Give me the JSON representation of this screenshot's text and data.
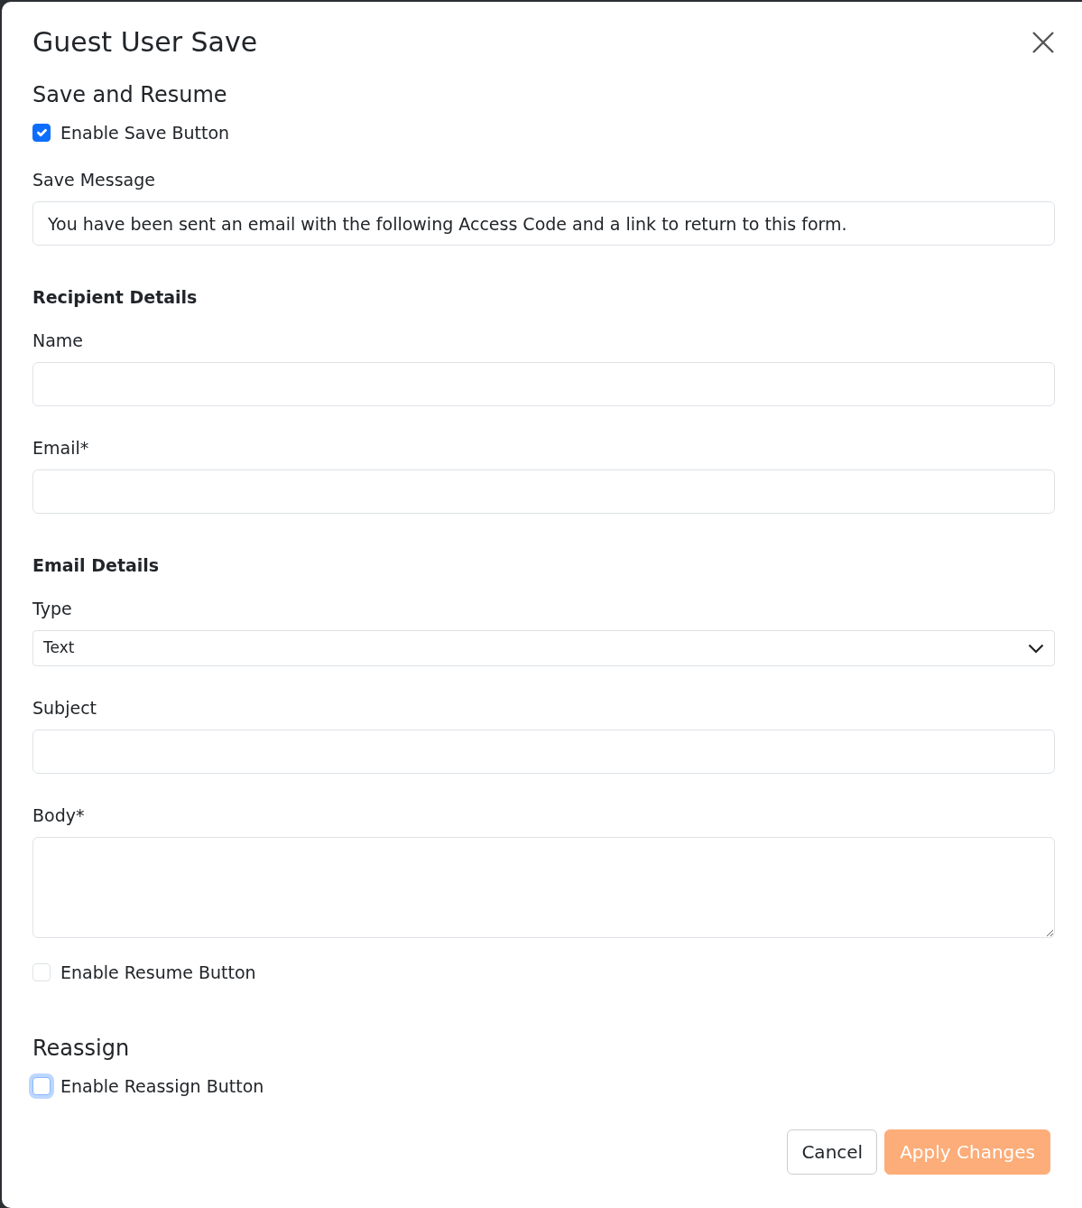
{
  "dialog": {
    "title": "Guest User Save"
  },
  "items": [
    {
      "kind": "heading",
      "text": "Save and Resume"
    },
    {
      "kind": "checkbox",
      "label": "Enable Save Button",
      "checked": true,
      "focused": false
    },
    {
      "kind": "input",
      "label": "Save Message",
      "value": "You have been sent an email with the following Access Code and a link to return to this form."
    },
    {
      "kind": "subheading",
      "text": "Recipient Details"
    },
    {
      "kind": "input",
      "label": "Name",
      "value": ""
    },
    {
      "kind": "input",
      "label": "Email*",
      "value": ""
    },
    {
      "kind": "subheading",
      "text": "Email Details"
    },
    {
      "kind": "select",
      "label": "Type",
      "value": "Text"
    },
    {
      "kind": "input",
      "label": "Subject",
      "value": ""
    },
    {
      "kind": "textarea",
      "label": "Body*",
      "value": ""
    },
    {
      "kind": "checkbox",
      "label": "Enable Resume Button",
      "checked": false,
      "focused": false
    },
    {
      "kind": "heading",
      "text": "Reassign"
    },
    {
      "kind": "checkbox",
      "label": "Enable Reassign Button",
      "checked": false,
      "focused": true
    }
  ],
  "buttons": [
    {
      "label": "Cancel",
      "kind": "secondary",
      "disabled": false
    },
    {
      "label": "Apply Changes",
      "kind": "primary",
      "disabled": true
    }
  ]
}
